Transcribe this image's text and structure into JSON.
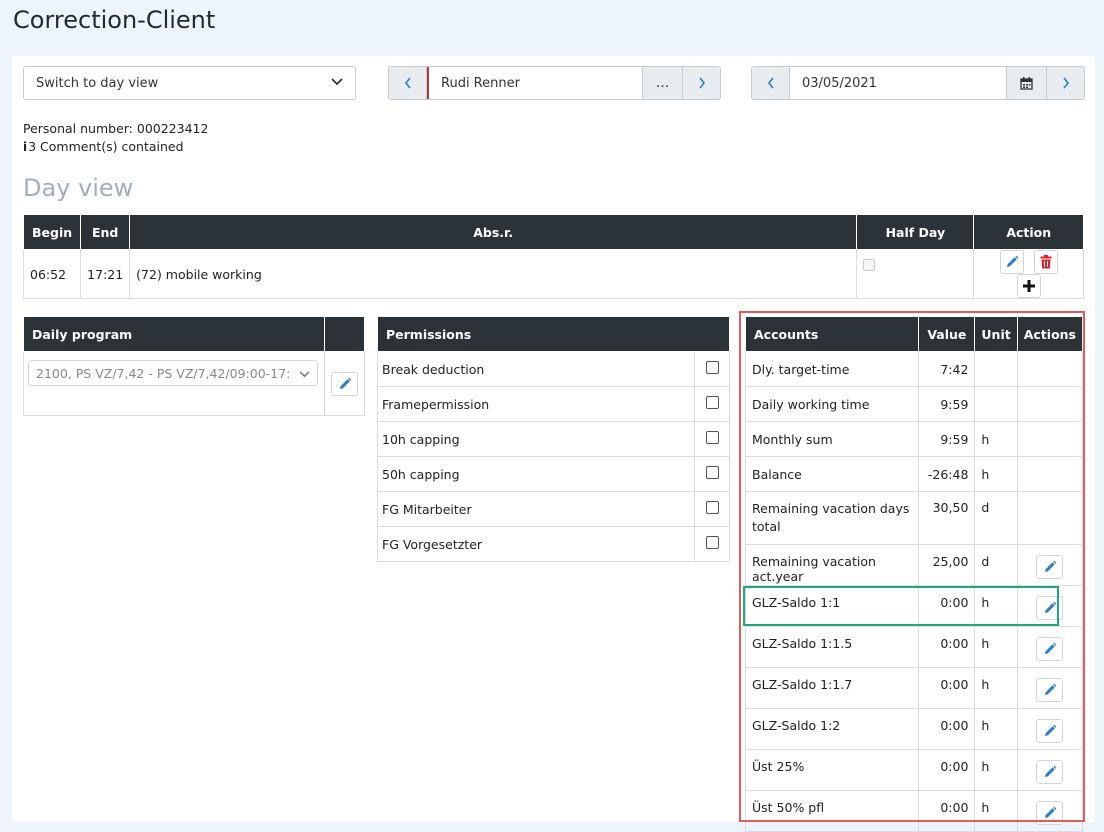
{
  "page": {
    "title": "Correction-Client"
  },
  "controls": {
    "view_select": "Switch to day view",
    "employee_name": "Rudi Renner",
    "more_label": "...",
    "date_value": "03/05/2021"
  },
  "info": {
    "personal_label": "Personal number:",
    "personal_number": "000223412",
    "comments": "3 Comment(s) contained"
  },
  "day_view": {
    "title": "Day view",
    "headers": {
      "begin": "Begin",
      "end": "End",
      "absr": "Abs.r.",
      "half_day": "Half Day",
      "action": "Action"
    },
    "row": {
      "begin": "06:52",
      "end": "17:21",
      "absr": "(72) mobile working"
    }
  },
  "daily_program": {
    "header": "Daily program",
    "value": "2100, PS VZ/7,42 - PS VZ/7,42/09:00-17:"
  },
  "permissions": {
    "header": "Permissions",
    "items": [
      {
        "label": "Break deduction"
      },
      {
        "label": "Framepermission"
      },
      {
        "label": "10h capping"
      },
      {
        "label": "50h capping"
      },
      {
        "label": "FG Mitarbeiter"
      },
      {
        "label": "FG Vorgesetzter"
      }
    ]
  },
  "accounts": {
    "headers": {
      "accounts": "Accounts",
      "value": "Value",
      "unit": "Unit",
      "actions": "Actions"
    },
    "rows": [
      {
        "name": "Dly. target-time",
        "value": "7:42",
        "unit": "",
        "editable": false
      },
      {
        "name": "Daily working time",
        "value": "9:59",
        "unit": "",
        "editable": false
      },
      {
        "name": "Monthly sum",
        "value": "9:59",
        "unit": "h",
        "editable": false
      },
      {
        "name": "Balance",
        "value": "-26:48",
        "unit": "h",
        "editable": false
      },
      {
        "name": "Remaining vacation days total",
        "value": "30,50",
        "unit": "d",
        "editable": false
      },
      {
        "name": "Remaining vacation act.year",
        "value": "25,00",
        "unit": "d",
        "editable": true
      },
      {
        "name": "GLZ-Saldo 1:1",
        "value": "0:00",
        "unit": "h",
        "editable": true
      },
      {
        "name": "GLZ-Saldo 1:1.5",
        "value": "0:00",
        "unit": "h",
        "editable": true
      },
      {
        "name": "GLZ-Saldo 1:1.7",
        "value": "0:00",
        "unit": "h",
        "editable": true
      },
      {
        "name": "GLZ-Saldo 1:2",
        "value": "0:00",
        "unit": "h",
        "editable": true
      },
      {
        "name": "Üst 25%",
        "value": "0:00",
        "unit": "h",
        "editable": true
      },
      {
        "name": "Üst 50% pfl",
        "value": "0:00",
        "unit": "h",
        "editable": true
      }
    ]
  },
  "colors": {
    "header_bg": "#2c3338",
    "accent_blue": "#2a7fc9",
    "delete_red": "#d9202a",
    "highlight_red": "#e35a5a",
    "highlight_green": "#1fa880"
  }
}
